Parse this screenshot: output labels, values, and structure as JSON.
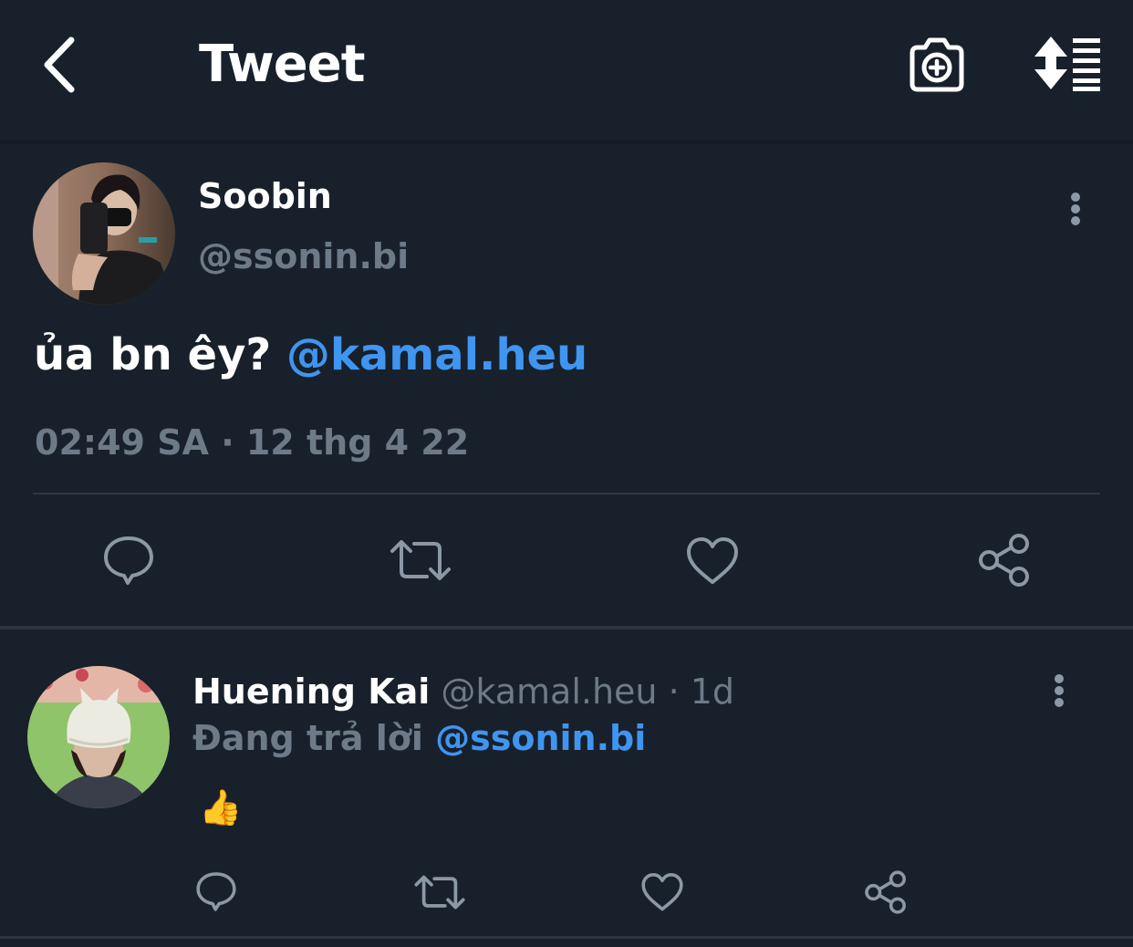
{
  "header": {
    "title": "Tweet",
    "back_icon": "chevron-left-icon",
    "camera_icon": "camera-plus-icon",
    "sort_icon": "sort-list-icon"
  },
  "main_tweet": {
    "author_name": "Soobin",
    "author_handle": "@ssonin.bi",
    "text_before": "ủa bn êy? ",
    "mention": "@kamal.heu",
    "timestamp": "02:49 SA · 12 thg 4 22"
  },
  "reply": {
    "author_name": "Huening Kai",
    "handle_time": " @kamal.heu · 1d",
    "replying_label": "Đang trả lời ",
    "replying_to": "@ssonin.bi",
    "text": "👍"
  },
  "colors": {
    "background": "#18202b",
    "accent": "#3f95f0",
    "muted": "#6d7a88"
  }
}
